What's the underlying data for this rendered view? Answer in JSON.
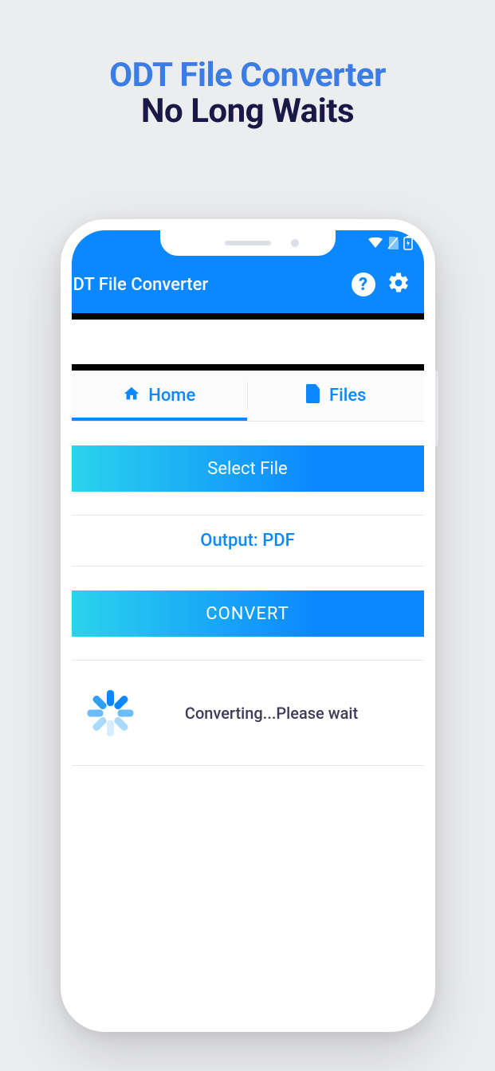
{
  "promo": {
    "line1": "ODT File Converter",
    "line2": "No Long Waits"
  },
  "appbar": {
    "title": "DT File Converter"
  },
  "tabs": {
    "home": "Home",
    "files": "Files"
  },
  "actions": {
    "select_file": "Select File",
    "output_label": "Output: PDF",
    "convert": "CONVERT"
  },
  "status": {
    "converting": "Converting...Please wait"
  },
  "colors": {
    "accent": "#0b87ff",
    "gradient_start": "#2bd3ec",
    "gradient_end": "#0b87ff",
    "dark_text": "#1a1847"
  },
  "icons": {
    "help": "?",
    "settings": "gear",
    "wifi": "wifi",
    "sim": "no-sim",
    "battery": "battery-charging",
    "home": "home",
    "file": "file"
  },
  "spinner_segments": [
    {
      "deg": 0,
      "color": "#0b87ff"
    },
    {
      "deg": 45,
      "color": "#0b87ff"
    },
    {
      "deg": 90,
      "color": "#6cbcf7"
    },
    {
      "deg": 135,
      "color": "#a9d9fb"
    },
    {
      "deg": 180,
      "color": "#d7ecfd"
    },
    {
      "deg": 225,
      "color": "#a9d9fb"
    },
    {
      "deg": 270,
      "color": "#6cbcf7"
    },
    {
      "deg": 315,
      "color": "#2fa0f5"
    }
  ]
}
